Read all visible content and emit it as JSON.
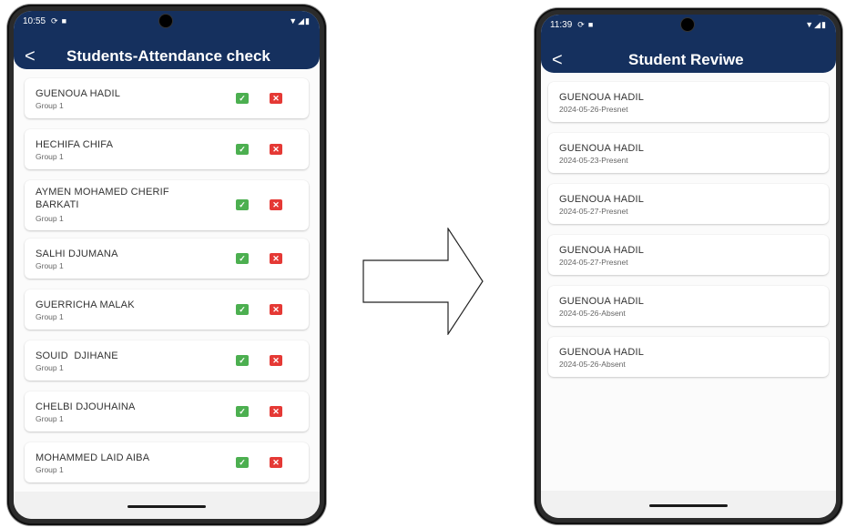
{
  "colors": {
    "header": "#15305e",
    "present": "#4caf50",
    "absent": "#e53935"
  },
  "left_phone": {
    "status": {
      "time": "10:55"
    },
    "title": "Students-Attendance check",
    "back_icon": "chevron-left-icon",
    "students": [
      {
        "name": "GUENOUA HADIL",
        "group": "Group 1"
      },
      {
        "name": "HECHIFA CHIFA",
        "group": "Group 1"
      },
      {
        "name": "AYMEN MOHAMED CHERIF BARKATI",
        "group": "Group 1"
      },
      {
        "name": "SALHI DJUMANA",
        "group": "Group 1"
      },
      {
        "name": "GUERRICHA MALAK",
        "group": "Group 1"
      },
      {
        "name": "SOUID  DJIHANE",
        "group": "Group 1"
      },
      {
        "name": "CHELBI DJOUHAINA",
        "group": "Group 1"
      },
      {
        "name": "MOHAMMED LAID AIBA",
        "group": "Group 1"
      }
    ]
  },
  "arrow_icon": "right-arrow-icon",
  "right_phone": {
    "status": {
      "time": "11:39"
    },
    "title": "Student Reviwe",
    "back_icon": "chevron-left-icon",
    "records": [
      {
        "name": "GUENOUA HADIL",
        "detail": "2024-05-26-Presnet"
      },
      {
        "name": "GUENOUA HADIL",
        "detail": "2024-05-23-Present"
      },
      {
        "name": "GUENOUA HADIL",
        "detail": "2024-05-27-Presnet"
      },
      {
        "name": "GUENOUA HADIL",
        "detail": "2024-05-27-Presnet"
      },
      {
        "name": "GUENOUA HADIL",
        "detail": "2024-05-26-Absent"
      },
      {
        "name": "GUENOUA HADIL",
        "detail": "2024-05-26-Absent"
      }
    ]
  }
}
